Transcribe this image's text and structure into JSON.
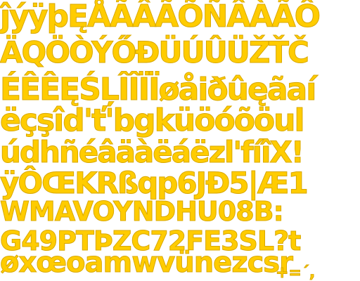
{
  "glyph_atlas": {
    "fill_color": "#ffcc00",
    "outline_color": "#d9a800",
    "background_color": "#ffffff",
    "rows": [
      "ĵýÿþĘÅÃÂÃÕÑÂÀÃÔ",
      "ÄQÖÒÝŐĐÜÚÛÜŽŤČ",
      "ÉÊÊĘŚĻÎÎÏÏøåiðûęãaí",
      "ëçşîd'ť'bgküöóõöul",
      "údhñéâäàëáëzl'fíîX!",
      "ÿÔŒKRßqp6JĐ5|Æ1",
      "WMAVOYNDHU08B:",
      "G49PTÞZC72FE3SL?t",
      "øxœoamwvünezcsr",
      "+=´,"
    ]
  }
}
